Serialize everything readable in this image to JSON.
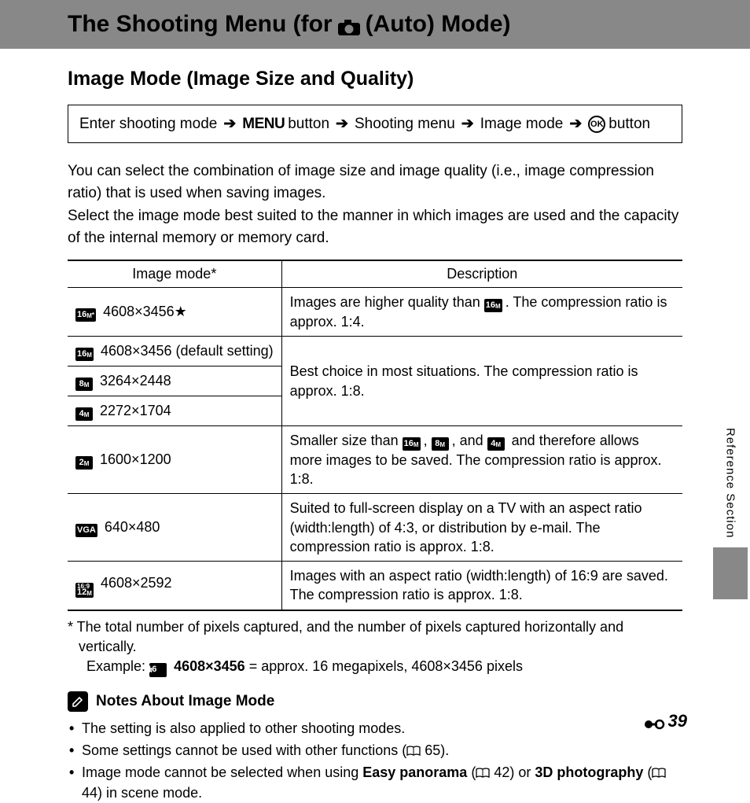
{
  "header": {
    "title_pre": "The Shooting Menu (for",
    "title_post": "(Auto) Mode)",
    "camera_icon": "camera-icon"
  },
  "subtitle": "Image Mode (Image Size and Quality)",
  "nav": {
    "step1": "Enter shooting mode",
    "step2": "button",
    "step2_icon": "MENU",
    "step3": "Shooting menu",
    "step4": "Image mode",
    "step5": "button",
    "arrow": "➔"
  },
  "intro": {
    "p1": "You can select the combination of image size and image quality (i.e., image compression ratio) that is used when saving images.",
    "p2": "Select the image mode best suited to the manner in which images are used and the capacity of the internal memory or memory card."
  },
  "table": {
    "head1": "Image mode*",
    "head2": "Description",
    "rows": [
      {
        "icon": "16M*",
        "label": "4608×3456",
        "star": "★",
        "desc_pre": "Images are higher quality than ",
        "desc_icon": "16M",
        "desc_post": ". The compression ratio is approx. 1:4."
      },
      {
        "icon": "16M",
        "label": "4608×3456 (default setting)"
      },
      {
        "icon": "8M",
        "label": "3264×2448"
      },
      {
        "icon": "4M",
        "label": "2272×1704"
      },
      {
        "desc_merged": "Best choice in most situations. The compression ratio is approx. 1:8."
      },
      {
        "icon": "2M",
        "label": "1600×1200",
        "desc_pre": "Smaller size than ",
        "desc_icons": [
          "16M",
          "8M",
          "4M"
        ],
        "desc_post": " and therefore allows more images to be saved. The compression ratio is approx. 1:8."
      },
      {
        "icon": "VGA",
        "label": "640×480",
        "desc": "Suited to full-screen display on a TV with an aspect ratio (width:length) of 4:3, or distribution by e-mail. The compression ratio is approx. 1:8."
      },
      {
        "icon": "16:9 12M",
        "label": "4608×2592",
        "desc": "Images with an aspect ratio (width:length) of 16:9 are saved. The compression ratio is approx. 1:8."
      }
    ]
  },
  "footnote": {
    "pre": "* The total number of pixels captured, and the number of pixels captured horizontally and vertically.",
    "example_label": "Example:",
    "example_icon": "16M",
    "example_bold": "4608×3456",
    "example_post": "= approx. 16 megapixels, 4608×3456 pixels"
  },
  "notes": {
    "title": "Notes About Image Mode",
    "items": {
      "n1": "The setting is also applied to other shooting modes.",
      "n2_pre": "Some settings cannot be used with other functions (",
      "n2_ref": "65",
      "n2_post": ").",
      "n3_pre": "Image mode cannot be selected when using ",
      "n3_b1": "Easy panorama",
      "n3_mid1": " (",
      "n3_r1": "42",
      "n3_mid2": ") or ",
      "n3_b2": "3D photography",
      "n3_mid3": " (",
      "n3_r2": "44",
      "n3_post": ") in scene mode."
    }
  },
  "side": {
    "label": "Reference Section"
  },
  "page_number": "39"
}
